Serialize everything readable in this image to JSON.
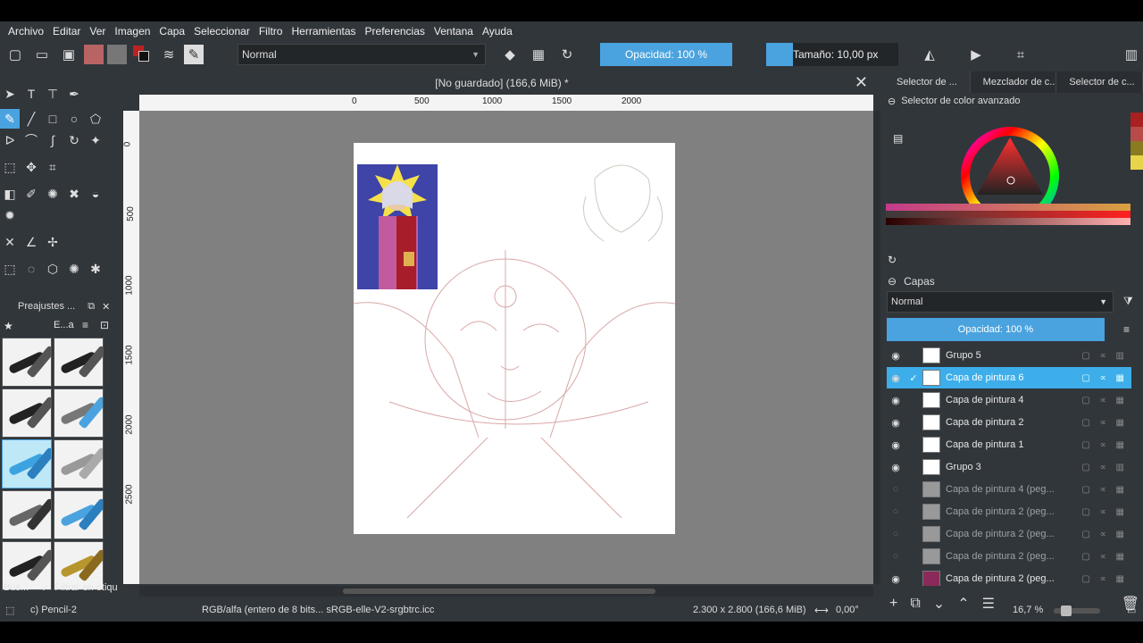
{
  "menu": [
    "Archivo",
    "Editar",
    "Ver",
    "Imagen",
    "Capa",
    "Seleccionar",
    "Filtro",
    "Herramientas",
    "Preferencias",
    "Ventana",
    "Ayuda"
  ],
  "toolbar": {
    "blend_mode": "Normal",
    "opacity": "Opacidad: 100 %",
    "size": "Tamaño: 10,00 px"
  },
  "document": {
    "title": "[No guardado]  (166,6 MiB) *",
    "ruler_h": [
      "0",
      "500",
      "1000",
      "1500",
      "2000"
    ],
    "ruler_v": [
      "0",
      "500",
      "1000",
      "1500",
      "2000",
      "2500"
    ]
  },
  "presets": {
    "title": "Preajustes ...",
    "tag_label": "E...a",
    "search": "Bus...",
    "filter_label": "Filtrar en etiqu"
  },
  "right_panel": {
    "tabs": [
      "Selector de ...",
      "Mezclador de c...",
      "Selector de c..."
    ],
    "color_title": "Selector de color avanzado",
    "layers_title": "Capas",
    "layer_blend": "Normal",
    "layer_opacity": "Opacidad:  100 %",
    "layers": [
      {
        "name": "Grupo 5",
        "visible": true,
        "group": true
      },
      {
        "name": "Capa de pintura 6",
        "visible": true,
        "selected": true
      },
      {
        "name": "Capa de pintura 4",
        "visible": true
      },
      {
        "name": "Capa de pintura 2",
        "visible": true
      },
      {
        "name": "Capa de pintura 1",
        "visible": true
      },
      {
        "name": "Grupo 3",
        "visible": true,
        "group": true
      },
      {
        "name": "Capa de pintura 4 (peg...",
        "visible": false
      },
      {
        "name": "Capa de pintura 2 (peg...",
        "visible": false
      },
      {
        "name": "Capa de pintura 2 (peg...",
        "visible": false
      },
      {
        "name": "Capa de pintura 2 (peg...",
        "visible": false
      },
      {
        "name": "Capa de pintura 2 (peg...",
        "visible": true
      }
    ]
  },
  "status": {
    "brush": "c) Pencil-2",
    "color_space": "RGB/alfa (entero de 8 bits...  sRGB-elle-V2-srgbtrc.icc",
    "dimensions": "2.300 x 2.800 (166,6 MiB)",
    "rotation": "0,00°",
    "zoom": "16,7 %"
  },
  "colors": {
    "accent": "#4aa3df",
    "panel": "#31363b"
  }
}
